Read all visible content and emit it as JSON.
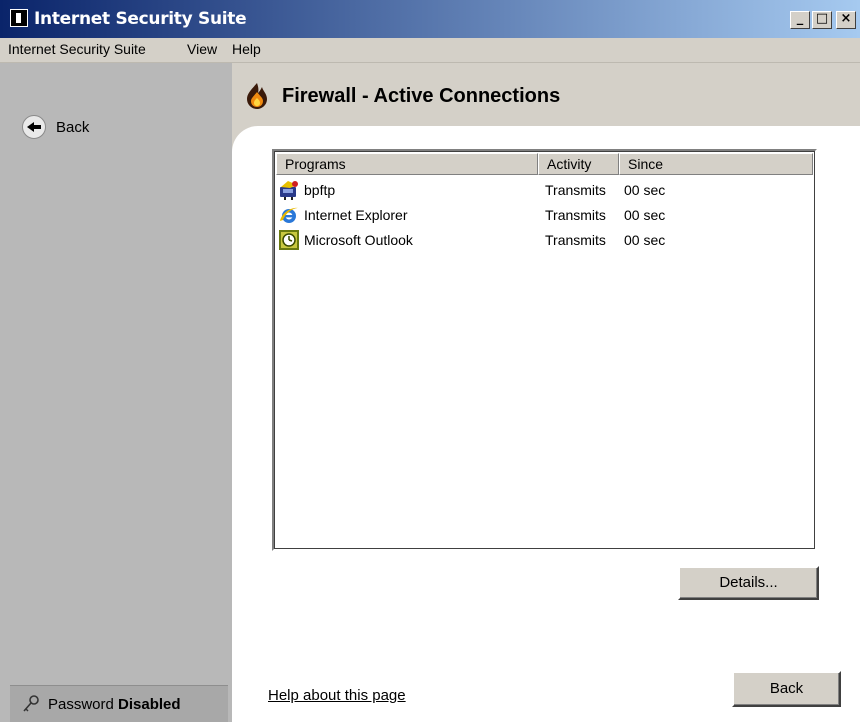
{
  "window": {
    "title": "Internet Security Suite",
    "minimize_glyph": "_",
    "maximize_glyph": "□",
    "close_glyph": "×"
  },
  "menu": {
    "items": [
      "Internet Security Suite",
      "View",
      "Help"
    ]
  },
  "sidebar": {
    "back_label": "Back",
    "password_label": "Password",
    "password_status": "Disabled"
  },
  "header": {
    "title": "Firewall - Active Connections",
    "icon": "flame-icon"
  },
  "connections": {
    "columns": [
      "Programs",
      "Activity",
      "Since"
    ],
    "rows": [
      {
        "program": "bpftp",
        "activity": "Transmits",
        "since": "00 sec",
        "icon": "bpftp-icon"
      },
      {
        "program": "Internet Explorer",
        "activity": "Transmits",
        "since": "00 sec",
        "icon": "internet-explorer-icon"
      },
      {
        "program": "Microsoft Outlook",
        "activity": "Transmits",
        "since": "00 sec",
        "icon": "outlook-icon"
      }
    ]
  },
  "buttons": {
    "details": "Details...",
    "back": "Back"
  },
  "help_link": "Help about this page",
  "colors": {
    "title_bar_start": "#0a246a",
    "title_bar_end": "#a6caf0",
    "sidebar": "#b8b8b8",
    "panel": "#ffffff",
    "chrome": "#d4d0c8"
  }
}
